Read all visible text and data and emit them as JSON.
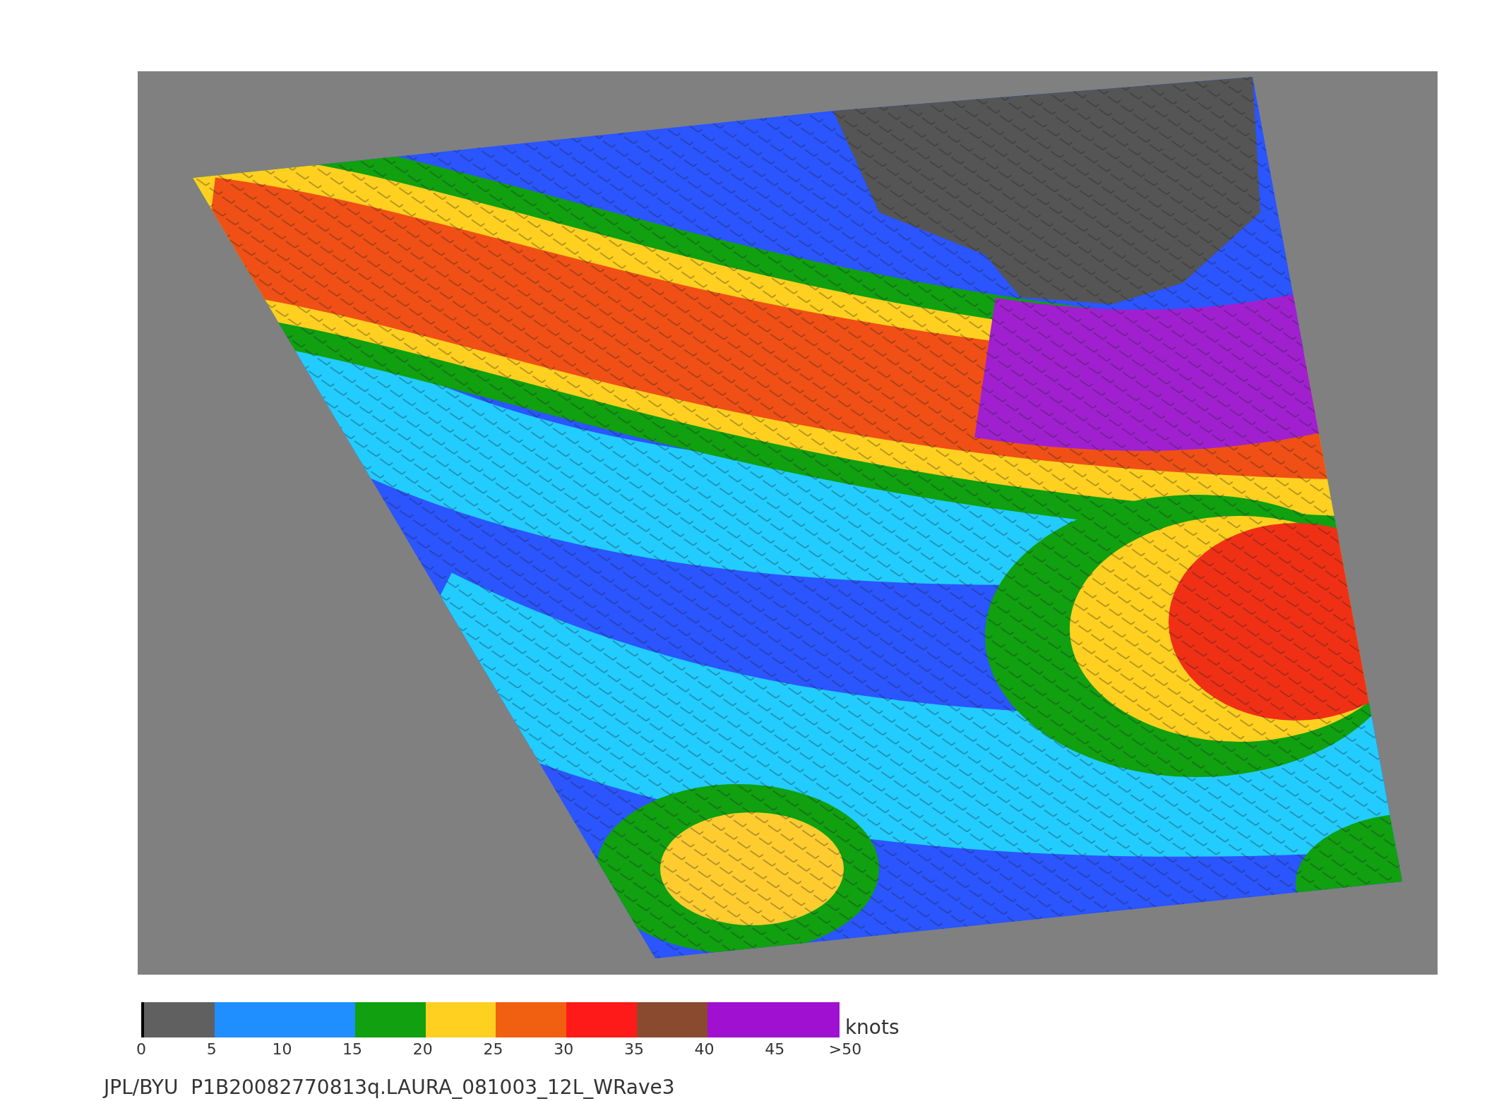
{
  "colorbar": {
    "segments": [
      {
        "color": "#606060"
      },
      {
        "color": "#1f8fff"
      },
      {
        "color": "#10a010"
      },
      {
        "color": "#ffd020"
      },
      {
        "color": "#f06010"
      },
      {
        "color": "#ff1a1a"
      },
      {
        "color": "#8a4a30"
      },
      {
        "color": "#a010d0"
      }
    ],
    "tick_labels": [
      "0",
      "5",
      "10",
      "15",
      "20",
      "25",
      "30",
      "35",
      "40",
      "45",
      ">50"
    ],
    "unit": "knots"
  },
  "caption": "JPL/BYU  P1B20082770813q.LAURA_081003_12L_WRave3"
}
